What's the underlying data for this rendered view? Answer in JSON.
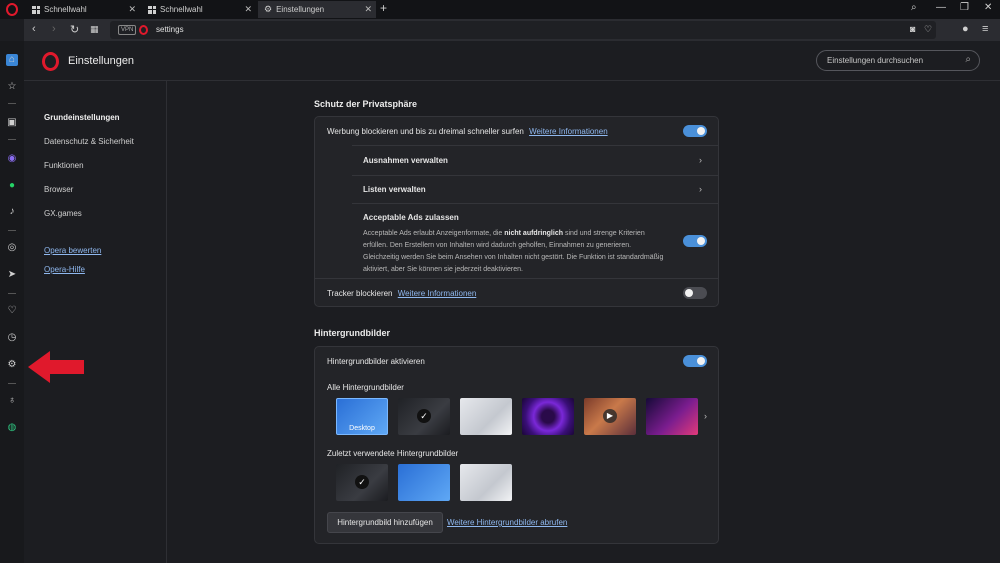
{
  "tabs": [
    {
      "label": "Schnellwahl"
    },
    {
      "label": "Schnellwahl"
    },
    {
      "label": "Einstellungen"
    }
  ],
  "address": {
    "vpn": "VPN",
    "url": "settings"
  },
  "header": {
    "title": "Einstellungen",
    "search_placeholder": "Einstellungen durchsuchen"
  },
  "settings_nav": {
    "items": [
      "Grundeinstellungen",
      "Datenschutz & Sicherheit",
      "Funktionen",
      "Browser",
      "GX.games"
    ],
    "links": [
      "Opera bewerten",
      "Opera-Hilfe"
    ]
  },
  "privacy": {
    "title": "Schutz der Privatsphäre",
    "adblock_label": "Werbung blockieren und bis zu dreimal schneller surfen",
    "adblock_link": "Weitere Informationen",
    "adblock_on": true,
    "exceptions_label": "Ausnahmen verwalten",
    "lists_label": "Listen verwalten",
    "acceptable_title": "Acceptable Ads zulassen",
    "acceptable_desc_1": "Acceptable Ads erlaubt Anzeigenformate, die ",
    "acceptable_desc_bold": "nicht aufdringlich",
    "acceptable_desc_2": " sind und strenge Kriterien erfüllen. Den Erstellern von Inhalten wird dadurch geholfen, Einnahmen zu generieren. Gleichzeitig werden Sie beim Ansehen von Inhalten nicht gestört. Die Funktion ist standardmäßig aktiviert, aber Sie können sie jederzeit deaktivieren.",
    "acceptable_on": true,
    "tracker_label": "Tracker blockieren",
    "tracker_link": "Weitere Informationen",
    "tracker_on": false
  },
  "wallpapers": {
    "title": "Hintergrundbilder",
    "enable_label": "Hintergrundbilder aktivieren",
    "enable_on": true,
    "all_label": "Alle Hintergrundbilder",
    "desktop_label": "Desktop",
    "recent_label": "Zuletzt verwendete Hintergrundbilder",
    "add_button": "Hintergrundbild hinzufügen",
    "more_link": "Weitere Hintergrundbilder abrufen"
  },
  "colors": {
    "accent": "#4a90d9",
    "opera_red": "#e0192c",
    "link": "#8fb8ef"
  }
}
